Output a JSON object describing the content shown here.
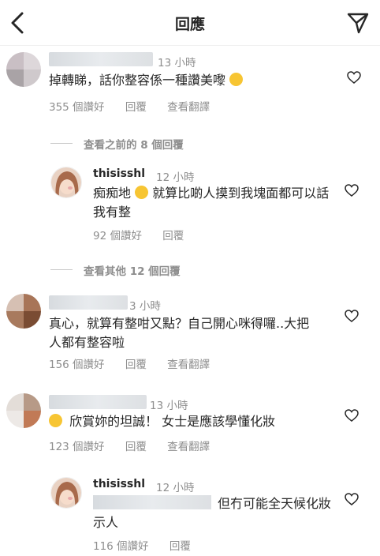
{
  "header": {
    "title": "回應"
  },
  "comments": [
    {
      "time": "13 小時",
      "text": "掉轉睇，話你整容係一種讚美嚟",
      "likes": "355 個讚好",
      "reply": "回覆",
      "translate": "查看翻譯"
    },
    {
      "username": "thisisshl",
      "time": "12 小時",
      "text_before": "痴痴地",
      "text_after": "就算比啲人摸到我塊面都可以話我有整",
      "likes": "92 個讚好",
      "reply": "回覆"
    },
    {
      "time": "3 小時",
      "text": "真心，就算有整咁又點？自己開心咪得囉..大把人都有整容啦",
      "likes": "156 個讚好",
      "reply": "回覆",
      "translate": "查看翻譯"
    },
    {
      "time": "13 小時",
      "text": "欣賞妳的坦誠！ 女士是應該學懂化妝",
      "likes": "123 個讚好",
      "reply": "回覆",
      "translate": "查看翻譯"
    },
    {
      "username": "thisisshl",
      "time": "12 小時",
      "text": "但冇可能全天候化妝示人",
      "likes": "116 個讚好",
      "reply": "回覆"
    }
  ],
  "dividers": {
    "previous": "查看之前的 8 個回覆",
    "other": "查看其他 12 個回覆"
  },
  "colors": {
    "text": "#262626",
    "muted": "#8e8e8e",
    "divider": "#efefef"
  }
}
